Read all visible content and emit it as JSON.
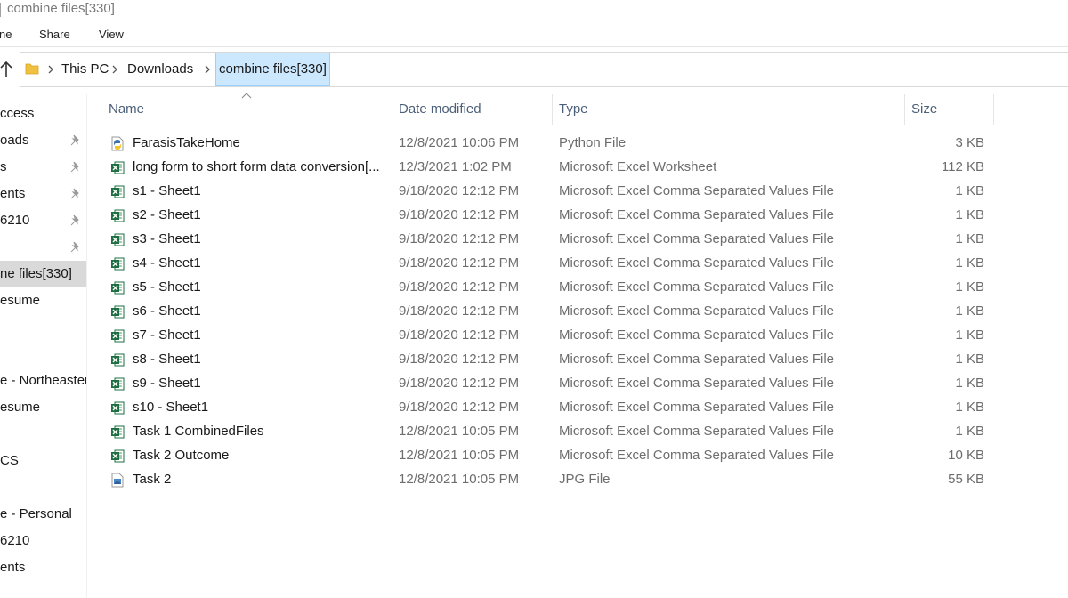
{
  "window": {
    "title": "combine files[330]"
  },
  "ribbon": {
    "tabs": [
      "ne",
      "Share",
      "View"
    ]
  },
  "breadcrumb": {
    "items": [
      "This PC",
      "Downloads",
      "combine files[330]"
    ]
  },
  "sidebar": {
    "items": [
      {
        "label": "ccess",
        "pinned": false,
        "selected": false
      },
      {
        "label": "oads",
        "pinned": true,
        "selected": false
      },
      {
        "label": "s",
        "pinned": true,
        "selected": false
      },
      {
        "label": "ents",
        "pinned": true,
        "selected": false
      },
      {
        "label": "6210",
        "pinned": true,
        "selected": false
      },
      {
        "label": "",
        "pinned": true,
        "selected": false
      },
      {
        "label": "ne files[330]",
        "pinned": false,
        "selected": true
      },
      {
        "label": "esume",
        "pinned": false,
        "selected": false
      },
      {
        "label": "",
        "pinned": false,
        "selected": false
      },
      {
        "label": "",
        "pinned": false,
        "selected": false
      },
      {
        "label": "e - Northeaster",
        "pinned": false,
        "selected": false
      },
      {
        "label": "esume",
        "pinned": false,
        "selected": false
      },
      {
        "label": "",
        "pinned": false,
        "selected": false
      },
      {
        "label": "CS",
        "pinned": false,
        "selected": false
      },
      {
        "label": "",
        "pinned": false,
        "selected": false
      },
      {
        "label": "e - Personal",
        "pinned": false,
        "selected": false
      },
      {
        "label": "6210",
        "pinned": false,
        "selected": false
      },
      {
        "label": "ents",
        "pinned": false,
        "selected": false
      }
    ]
  },
  "columns": {
    "name": "Name",
    "date": "Date modified",
    "type": "Type",
    "size": "Size"
  },
  "files": [
    {
      "name": "FarasisTakeHome",
      "date": "12/8/2021 10:06 PM",
      "type": "Python File",
      "size": "3 KB",
      "icon": "python-file-icon"
    },
    {
      "name": "long form to short form data conversion[...",
      "date": "12/3/2021 1:02 PM",
      "type": "Microsoft Excel Worksheet",
      "size": "112 KB",
      "icon": "excel-file-icon"
    },
    {
      "name": "s1 - Sheet1",
      "date": "9/18/2020 12:12 PM",
      "type": "Microsoft Excel Comma Separated Values File",
      "size": "1 KB",
      "icon": "excel-csv-icon"
    },
    {
      "name": "s2 - Sheet1",
      "date": "9/18/2020 12:12 PM",
      "type": "Microsoft Excel Comma Separated Values File",
      "size": "1 KB",
      "icon": "excel-csv-icon"
    },
    {
      "name": "s3 - Sheet1",
      "date": "9/18/2020 12:12 PM",
      "type": "Microsoft Excel Comma Separated Values File",
      "size": "1 KB",
      "icon": "excel-csv-icon"
    },
    {
      "name": "s4 - Sheet1",
      "date": "9/18/2020 12:12 PM",
      "type": "Microsoft Excel Comma Separated Values File",
      "size": "1 KB",
      "icon": "excel-csv-icon"
    },
    {
      "name": "s5 - Sheet1",
      "date": "9/18/2020 12:12 PM",
      "type": "Microsoft Excel Comma Separated Values File",
      "size": "1 KB",
      "icon": "excel-csv-icon"
    },
    {
      "name": "s6 - Sheet1",
      "date": "9/18/2020 12:12 PM",
      "type": "Microsoft Excel Comma Separated Values File",
      "size": "1 KB",
      "icon": "excel-csv-icon"
    },
    {
      "name": "s7 - Sheet1",
      "date": "9/18/2020 12:12 PM",
      "type": "Microsoft Excel Comma Separated Values File",
      "size": "1 KB",
      "icon": "excel-csv-icon"
    },
    {
      "name": "s8 - Sheet1",
      "date": "9/18/2020 12:12 PM",
      "type": "Microsoft Excel Comma Separated Values File",
      "size": "1 KB",
      "icon": "excel-csv-icon"
    },
    {
      "name": "s9 - Sheet1",
      "date": "9/18/2020 12:12 PM",
      "type": "Microsoft Excel Comma Separated Values File",
      "size": "1 KB",
      "icon": "excel-csv-icon"
    },
    {
      "name": "s10 - Sheet1",
      "date": "9/18/2020 12:12 PM",
      "type": "Microsoft Excel Comma Separated Values File",
      "size": "1 KB",
      "icon": "excel-csv-icon"
    },
    {
      "name": "Task 1 CombinedFiles",
      "date": "12/8/2021 10:05 PM",
      "type": "Microsoft Excel Comma Separated Values File",
      "size": "1 KB",
      "icon": "excel-csv-icon"
    },
    {
      "name": "Task 2 Outcome",
      "date": "12/8/2021 10:05 PM",
      "type": "Microsoft Excel Comma Separated Values File",
      "size": "10 KB",
      "icon": "excel-csv-icon"
    },
    {
      "name": "Task 2",
      "date": "12/8/2021 10:05 PM",
      "type": "JPG File",
      "size": "55 KB",
      "icon": "jpg-file-icon"
    }
  ],
  "colors": {
    "selection": "#cce8ff",
    "excel_green": "#1d6f42",
    "header_text": "#4c607a",
    "folder_yellow": "#f0c040"
  }
}
